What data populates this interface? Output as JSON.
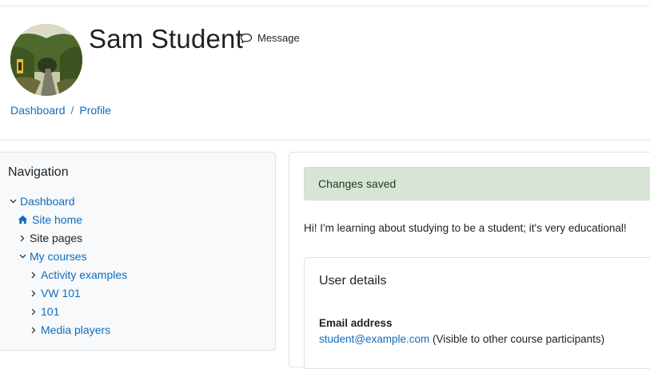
{
  "user": {
    "name": "Sam Student",
    "message_label": "Message"
  },
  "icons": {
    "message": "speech-bubble-icon",
    "home": "home-icon",
    "expanded": "chevron-down-icon",
    "collapsed": "chevron-right-icon"
  },
  "breadcrumb": {
    "items": [
      "Dashboard",
      "Profile"
    ],
    "separator": "/"
  },
  "navigation": {
    "title": "Navigation",
    "items": [
      {
        "label": "Dashboard",
        "state": "expanded",
        "link": true
      },
      {
        "label": "Site home",
        "state": "home",
        "link": true
      },
      {
        "label": "Site pages",
        "state": "collapsed",
        "link": false
      },
      {
        "label": "My courses",
        "state": "expanded",
        "link": true
      },
      {
        "label": "Activity examples",
        "state": "collapsed",
        "link": true
      },
      {
        "label": "VW 101",
        "state": "collapsed",
        "link": true
      },
      {
        "label": "101",
        "state": "collapsed",
        "link": true
      },
      {
        "label": "Media players",
        "state": "collapsed",
        "link": true
      }
    ]
  },
  "main": {
    "alert": "Changes saved",
    "description": "Hi! I'm learning about studying to be a student; it's very educational!",
    "user_details": {
      "title": "User details",
      "email_label": "Email address",
      "email_value": "student@example.com",
      "email_note": "(Visible to other course participants)"
    }
  },
  "colors": {
    "link": "#0f6cbf",
    "alert_bg": "#d7e4d6",
    "nav_bg": "#f8f9fa",
    "border": "#dee2e6"
  }
}
